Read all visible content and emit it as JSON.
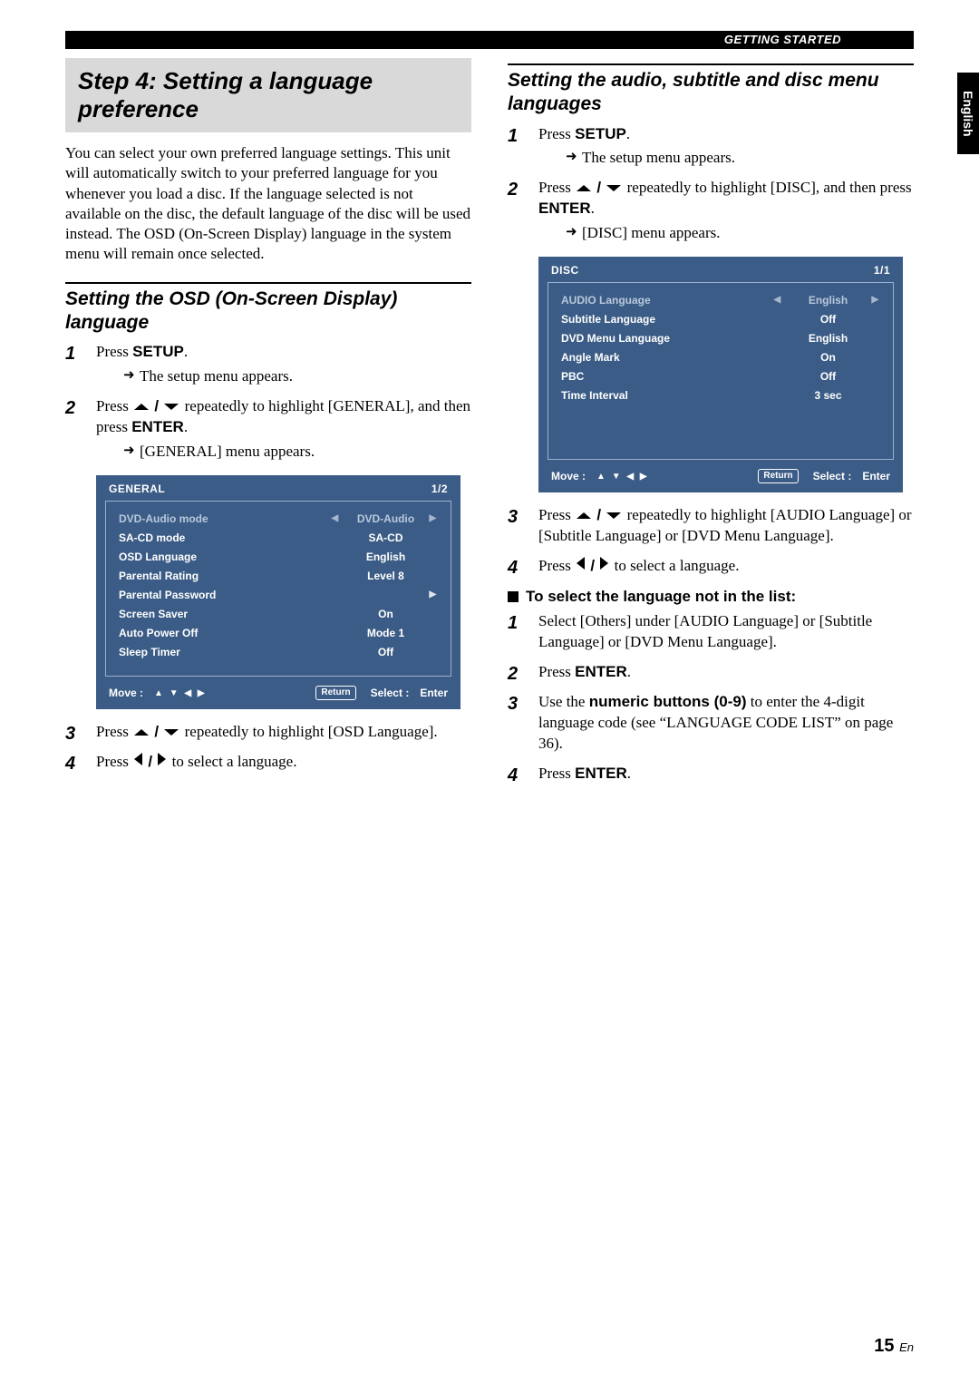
{
  "top_bar_label": "GETTING STARTED",
  "lang_tab": "English",
  "page_number_num": "15",
  "page_number_suffix": "En",
  "left": {
    "step_title": "Step 4: Setting a language preference",
    "intro": "You can select your own preferred language settings. This unit will automatically switch to your preferred language for you whenever you load a disc. If the language selected is not available on the disc, the default language of the disc will be used instead. The OSD (On-Screen Display) language in the system menu will remain once selected.",
    "section_head": "Setting the OSD (On-Screen Display) language",
    "s1_prefix": "Press ",
    "s1_key": "SETUP",
    "s1_suffix": ".",
    "s1_result": "The setup menu appears.",
    "s2_prefix": "Press ",
    "s2_mid": " repeatedly to highlight [GENERAL], and then press ",
    "s2_key": "ENTER",
    "s2_suffix": ".",
    "s2_result": "[GENERAL] menu appears.",
    "s3_prefix": "Press ",
    "s3_suffix": " repeatedly to highlight [OSD Language].",
    "s4_prefix": "Press ",
    "s4_suffix": " to select a language.",
    "osd": {
      "title": "GENERAL",
      "page": "1/2",
      "rows": [
        {
          "label": "DVD-Audio mode",
          "value": "DVD-Audio",
          "left_arrow": true,
          "right_arrow": true,
          "active": true
        },
        {
          "label": "SA-CD mode",
          "value": "SA-CD"
        },
        {
          "label": "OSD Language",
          "value": "English"
        },
        {
          "label": "Parental Rating",
          "value": "Level 8"
        },
        {
          "label": "Parental Password",
          "value": "",
          "right_arrow": true
        },
        {
          "label": "Screen Saver",
          "value": "On"
        },
        {
          "label": "Auto Power Off",
          "value": "Mode 1"
        },
        {
          "label": "Sleep Timer",
          "value": "Off"
        }
      ],
      "move_label": "Move :",
      "return_label": "Return",
      "select_label": "Select :",
      "enter_label": "Enter"
    }
  },
  "right": {
    "section_head": "Setting the audio, subtitle and disc menu languages",
    "s1_prefix": "Press ",
    "s1_key": "SETUP",
    "s1_suffix": ".",
    "s1_result": "The setup menu appears.",
    "s2_prefix": "Press ",
    "s2_mid": " repeatedly to highlight [DISC], and then press ",
    "s2_key": "ENTER",
    "s2_suffix": ".",
    "s2_result": "[DISC] menu appears.",
    "s3_prefix": "Press ",
    "s3_suffix": " repeatedly to highlight [AUDIO Language] or [Subtitle Language] or [DVD Menu Language].",
    "s4_prefix": "Press ",
    "s4_suffix": " to select a language.",
    "sub_head": "To select the language not in the list:",
    "t1": "Select [Others] under [AUDIO Language] or [Subtitle Language] or [DVD Menu Language].",
    "t2_prefix": "Press ",
    "t2_key": "ENTER",
    "t2_suffix": ".",
    "t3_prefix": "Use the ",
    "t3_key": "numeric buttons (0-9)",
    "t3_suffix": " to enter the 4-digit language code (see “LANGUAGE CODE LIST” on page 36).",
    "t4_prefix": "Press ",
    "t4_key": "ENTER",
    "t4_suffix": ".",
    "osd": {
      "title": "DISC",
      "page": "1/1",
      "rows": [
        {
          "label": "AUDIO Language",
          "value": "English",
          "left_arrow": true,
          "right_arrow": true,
          "active": true
        },
        {
          "label": "Subtitle Language",
          "value": "Off"
        },
        {
          "label": "DVD Menu Language",
          "value": "English"
        },
        {
          "label": "Angle Mark",
          "value": "On"
        },
        {
          "label": "PBC",
          "value": "Off"
        },
        {
          "label": "Time Interval",
          "value": "3 sec"
        }
      ],
      "move_label": "Move :",
      "return_label": "Return",
      "select_label": "Select :",
      "enter_label": "Enter"
    }
  }
}
